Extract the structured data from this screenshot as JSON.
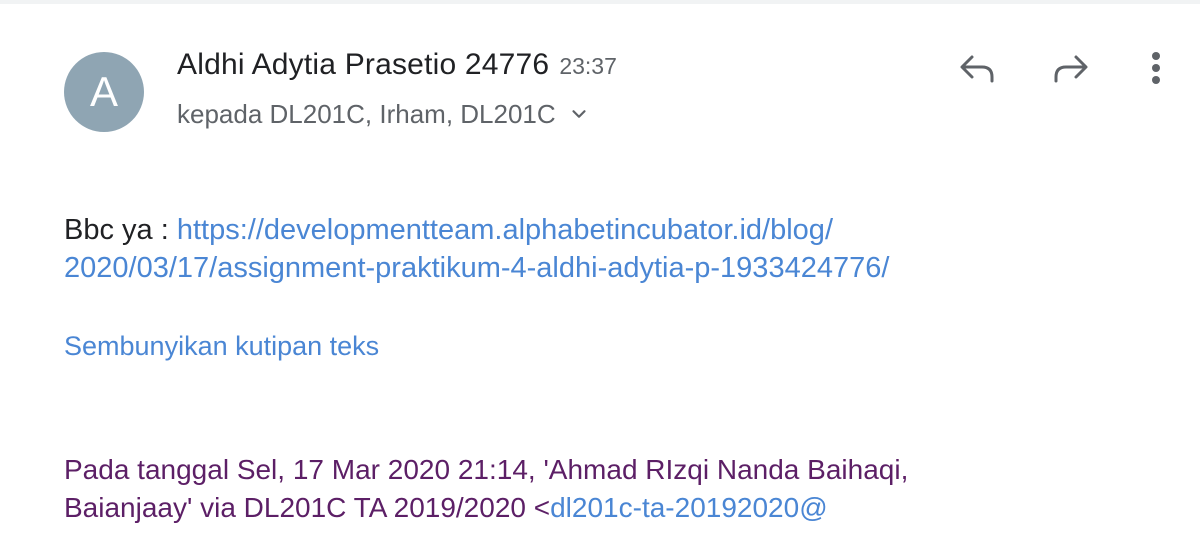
{
  "header": {
    "avatar_letter": "A",
    "sender_name": "Aldhi Adytia Prasetio 24776",
    "time": "23:37",
    "recipients": "kepada DL201C, Irham, DL201C"
  },
  "actions": {
    "reply_icon": "reply-icon",
    "forward_icon": "forward-icon",
    "more_icon": "more-vert-icon"
  },
  "body": {
    "prefix": "Bbc ya : ",
    "link_part1": "https://developmentteam.alphabetincubator.id/blog/",
    "link_part2": "2020/03/17/assignment-praktikum-4-aldhi-adytia-p-1933424776/",
    "hide_quote_label": "Sembunyikan kutipan teks"
  },
  "quote": {
    "line1": "Pada tanggal Sel, 17 Mar 2020 21:14, 'Ahmad RIzqi Nanda Baihaqi,",
    "line2_text": "Baianjaay' via DL201C TA 2019/2020 <",
    "line2_link": "dl201c-ta-20192020@"
  },
  "colors": {
    "avatar_bg": "#8fa5b3",
    "link": "#4a86d4",
    "quote_text": "#5c1f66",
    "muted": "#5f6368"
  }
}
